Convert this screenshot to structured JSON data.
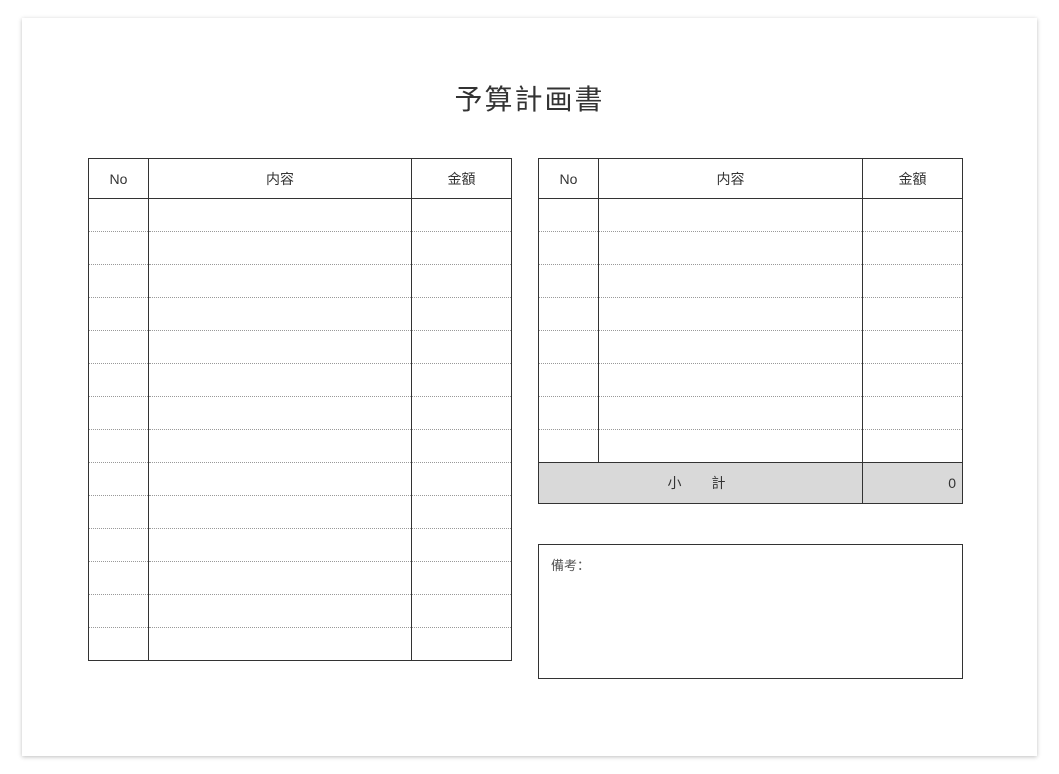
{
  "title": "予算計画書",
  "columns": {
    "no": "No",
    "content": "内容",
    "amount": "金額"
  },
  "leftTable": {
    "rows": [
      {
        "no": "",
        "content": "",
        "amount": ""
      },
      {
        "no": "",
        "content": "",
        "amount": ""
      },
      {
        "no": "",
        "content": "",
        "amount": ""
      },
      {
        "no": "",
        "content": "",
        "amount": ""
      },
      {
        "no": "",
        "content": "",
        "amount": ""
      },
      {
        "no": "",
        "content": "",
        "amount": ""
      },
      {
        "no": "",
        "content": "",
        "amount": ""
      },
      {
        "no": "",
        "content": "",
        "amount": ""
      },
      {
        "no": "",
        "content": "",
        "amount": ""
      },
      {
        "no": "",
        "content": "",
        "amount": ""
      },
      {
        "no": "",
        "content": "",
        "amount": ""
      },
      {
        "no": "",
        "content": "",
        "amount": ""
      },
      {
        "no": "",
        "content": "",
        "amount": ""
      },
      {
        "no": "",
        "content": "",
        "amount": ""
      }
    ]
  },
  "rightTable": {
    "rows": [
      {
        "no": "",
        "content": "",
        "amount": ""
      },
      {
        "no": "",
        "content": "",
        "amount": ""
      },
      {
        "no": "",
        "content": "",
        "amount": ""
      },
      {
        "no": "",
        "content": "",
        "amount": ""
      },
      {
        "no": "",
        "content": "",
        "amount": ""
      },
      {
        "no": "",
        "content": "",
        "amount": ""
      },
      {
        "no": "",
        "content": "",
        "amount": ""
      },
      {
        "no": "",
        "content": "",
        "amount": ""
      }
    ],
    "subtotal": {
      "label": "小　計",
      "value": "0"
    }
  },
  "notes": {
    "label": "備考："
  }
}
